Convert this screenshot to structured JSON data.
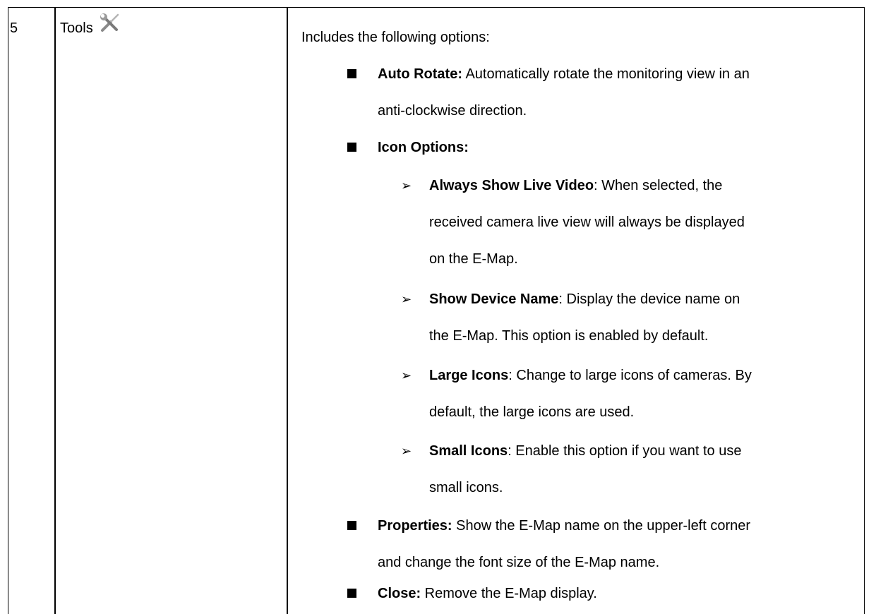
{
  "row": {
    "number": "5",
    "name": "Tools",
    "icon": "tools-icon",
    "intro": "Includes the following options:",
    "options": [
      {
        "term": "Auto Rotate:",
        "line1": " Automatically rotate the monitoring view in an",
        "line2": "anti-clockwise direction."
      },
      {
        "term": "Icon Options:",
        "sub": [
          {
            "term": "Always Show Live Video",
            "line1": ": When selected, the",
            "line2": "received camera live view will always be displayed",
            "line3": "on the E-Map."
          },
          {
            "term": "Show Device Name",
            "line1": ": Display the device name on",
            "line2": "the E-Map. This option is enabled by default."
          },
          {
            "term": "Large Icons",
            "line1": ": Change to large icons of cameras. By",
            "line2": "default, the large icons are used."
          },
          {
            "term": "Small Icons",
            "line1": ": Enable this option if you want to use",
            "line2": "small icons."
          }
        ]
      },
      {
        "term": "Properties:",
        "line1": " Show the E-Map name on the upper-left corner",
        "line2": "and change the font size of the E-Map name."
      },
      {
        "term": "Close:",
        "line1": " Remove the E-Map display."
      }
    ]
  }
}
